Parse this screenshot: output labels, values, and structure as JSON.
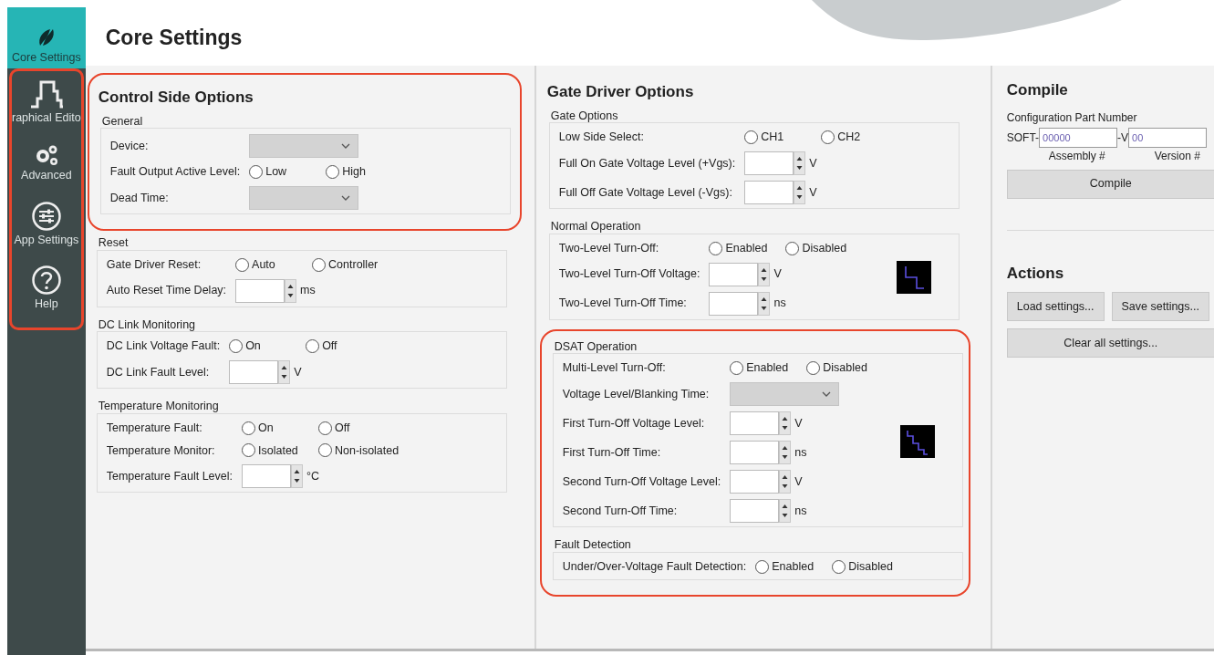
{
  "sidebar": {
    "groups": [
      {
        "highlighted": false,
        "items": [
          {
            "label": "Core Settings",
            "selected": true
          }
        ]
      },
      {
        "highlighted": true,
        "items": [
          {
            "label": "raphical Edito",
            "selected": false
          },
          {
            "label": "Advanced",
            "selected": false
          },
          {
            "label": "App Settings",
            "selected": false
          },
          {
            "label": "Help",
            "selected": false
          }
        ]
      }
    ]
  },
  "page_title": "Core Settings",
  "columns": [
    {
      "blocks": [
        {
          "highlighted": true,
          "title": "Control Side Options",
          "groups": [
            {
              "title": "General",
              "rows": [
                {
                  "kind": "select",
                  "label": "Device:"
                },
                {
                  "kind": "radio",
                  "label": "Fault Output Active Level:",
                  "options": [
                    {
                      "label": "Low",
                      "selected": false
                    },
                    {
                      "label": "High",
                      "selected": false
                    }
                  ]
                },
                {
                  "kind": "select",
                  "label": "Dead Time:"
                }
              ]
            }
          ]
        },
        {
          "highlighted": false,
          "groups": [
            {
              "title": "Reset",
              "rows": [
                {
                  "kind": "radio",
                  "label": "Gate Driver Reset:",
                  "options": [
                    {
                      "label": "Auto",
                      "selected": false
                    },
                    {
                      "label": "Controller",
                      "selected": false
                    }
                  ]
                },
                {
                  "kind": "spin",
                  "label": "Auto Reset Time Delay:",
                  "unit": "ms"
                }
              ]
            },
            {
              "title": "DC Link Monitoring",
              "rows": [
                {
                  "kind": "radio",
                  "label": "DC Link Voltage Fault:",
                  "options": [
                    {
                      "label": "On",
                      "selected": false
                    },
                    {
                      "label": "Off",
                      "selected": false
                    }
                  ]
                },
                {
                  "kind": "spin",
                  "label": "DC Link Fault Level:",
                  "unit": "V"
                }
              ]
            },
            {
              "title": "Temperature Monitoring",
              "rows": [
                {
                  "kind": "radio",
                  "label": "Temperature Fault:",
                  "options": [
                    {
                      "label": "On",
                      "selected": false
                    },
                    {
                      "label": "Off",
                      "selected": false
                    }
                  ]
                },
                {
                  "kind": "radio",
                  "label": "Temperature Monitor:",
                  "options": [
                    {
                      "label": "Isolated",
                      "selected": false
                    },
                    {
                      "label": "Non-isolated",
                      "selected": false
                    }
                  ]
                },
                {
                  "kind": "spin",
                  "label": "Temperature Fault Level:",
                  "unit": "°C"
                }
              ]
            }
          ]
        }
      ]
    },
    {
      "blocks": [
        {
          "highlighted": false,
          "title": "Gate Driver Options",
          "groups": [
            {
              "title": "Gate Options",
              "rows": [
                {
                  "kind": "radio",
                  "label": "Low Side Select:",
                  "options": [
                    {
                      "label": "CH1",
                      "selected": false
                    },
                    {
                      "label": "CH2",
                      "selected": false
                    }
                  ]
                },
                {
                  "kind": "spin",
                  "label": "Full On Gate Voltage Level (+Vgs):",
                  "unit": "V"
                },
                {
                  "kind": "spin",
                  "label": "Full Off Gate Voltage Level (-Vgs):",
                  "unit": "V"
                }
              ]
            },
            {
              "title": "Normal Operation",
              "waveform": true,
              "rows": [
                {
                  "kind": "radio",
                  "label": "Two-Level Turn-Off:",
                  "options": [
                    {
                      "label": "Enabled",
                      "selected": false
                    },
                    {
                      "label": "Disabled",
                      "selected": false
                    }
                  ]
                },
                {
                  "kind": "spin",
                  "label": "Two-Level Turn-Off Voltage:",
                  "unit": "V"
                },
                {
                  "kind": "spin",
                  "label": "Two-Level Turn-Off Time:",
                  "unit": "ns"
                }
              ]
            }
          ]
        },
        {
          "highlighted": true,
          "groups": [
            {
              "title": "DSAT Operation",
              "waveform": true,
              "rows": [
                {
                  "kind": "radio",
                  "label": "Multi-Level Turn-Off:",
                  "options": [
                    {
                      "label": "Enabled",
                      "selected": false
                    },
                    {
                      "label": "Disabled",
                      "selected": false
                    }
                  ]
                },
                {
                  "kind": "select",
                  "label": "Voltage Level/Blanking Time:"
                },
                {
                  "kind": "spin",
                  "label": "First Turn-Off Voltage Level:",
                  "unit": "V"
                },
                {
                  "kind": "spin",
                  "label": "First Turn-Off Time:",
                  "unit": "ns"
                },
                {
                  "kind": "spin",
                  "label": "Second Turn-Off Voltage Level:",
                  "unit": "V"
                },
                {
                  "kind": "spin",
                  "label": "Second Turn-Off Time:",
                  "unit": "ns"
                }
              ]
            },
            {
              "title": "Fault Detection",
              "rows": [
                {
                  "kind": "radio",
                  "label": "Under/Over-Voltage Fault Detection:",
                  "options": [
                    {
                      "label": "Enabled",
                      "selected": false
                    },
                    {
                      "label": "Disabled",
                      "selected": false
                    }
                  ]
                }
              ]
            }
          ]
        }
      ]
    }
  ],
  "compile": {
    "title": "Compile",
    "part_label": "Configuration Part Number",
    "prefix": "SOFT-",
    "assembly": "00000",
    "separator": "-V",
    "version": "00",
    "assembly_caption": "Assembly #",
    "version_caption": "Version #",
    "button": "Compile"
  },
  "actions": {
    "title": "Actions",
    "buttons": [
      {
        "label": "Load settings...",
        "wide": false
      },
      {
        "label": "Save settings...",
        "wide": false
      },
      {
        "label": "Clear all settings...",
        "wide": true
      }
    ]
  }
}
